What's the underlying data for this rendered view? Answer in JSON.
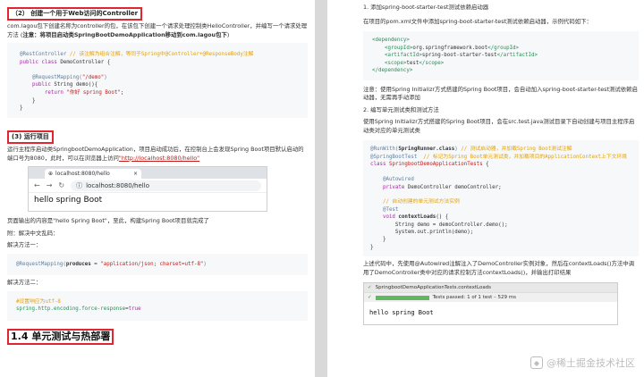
{
  "left": {
    "step2_title": "（2） 创建一个用于Web访问的Controller",
    "step2_desc": "com.lagou包下创建名称为controller的包，在该包下创建一个请求处理控制类HelloController，并编写一个请求处理方法 (",
    "step2_note": "注意：将项目启动类SpringBootDemoApplication移动到com.lagou包下",
    "step2_desc_end": ")",
    "code1": [
      {
        "parts": [
          {
            "c": "ann",
            "t": "@RestController "
          },
          {
            "c": "cm",
            "t": "// 该注解为组合注解，等同于Spring中@Controller+@ResponseBody注解"
          }
        ]
      },
      {
        "parts": [
          {
            "c": "kw",
            "t": "public class "
          },
          {
            "c": "",
            "t": "DemoController {"
          }
        ]
      },
      {
        "parts": [
          {
            "c": "",
            "t": ""
          }
        ]
      },
      {
        "parts": [
          {
            "c": "ann",
            "t": "    @RequestMapping("
          },
          {
            "c": "str",
            "t": "\"/demo\""
          },
          {
            "c": "ann",
            "t": ")"
          }
        ]
      },
      {
        "parts": [
          {
            "c": "kw",
            "t": "    public "
          },
          {
            "c": "",
            "t": "String demo(){"
          }
        ]
      },
      {
        "parts": [
          {
            "c": "kw",
            "t": "        return "
          },
          {
            "c": "str",
            "t": "\"你好 spring Boot\""
          },
          {
            "c": "",
            "t": ";"
          }
        ]
      },
      {
        "parts": [
          {
            "c": "",
            "t": "    }"
          }
        ]
      },
      {
        "parts": [
          {
            "c": "",
            "t": "}"
          }
        ]
      }
    ],
    "step3_title": "(3) 运行项目",
    "step3_desc": "运行主程序启动类SpringbootDemoApplication，项目启动成功后，在控制台上会发现Spring Boot项目默认启动的端口号为8080，此时，可以在浏览器上访问",
    "step3_link": "\"http://localhost:8080/hello\"",
    "browser": {
      "tab_title": "localhost:8080/hello",
      "url": "localhost:8080/hello",
      "content": "hello spring Boot"
    },
    "result_text": "页面输出的内容是\"hello Spring Boot\"，至此，构建Spring Boot项目就完成了",
    "appendix": "附：解决中文乱码：",
    "method1": "解决方法一：",
    "code2": [
      {
        "parts": [
          {
            "c": "ann",
            "t": "@RequestMapping("
          },
          {
            "c": "b",
            "t": "produces"
          },
          {
            "c": "",
            "t": " = "
          },
          {
            "c": "str",
            "t": "\"application/json; charset=utf-8\""
          },
          {
            "c": "ann",
            "t": ")"
          }
        ]
      }
    ],
    "method2": "解决方法二：",
    "code3": [
      {
        "parts": [
          {
            "c": "cm",
            "t": "#设置响应为utf-8"
          }
        ]
      },
      {
        "parts": [
          {
            "c": "grn",
            "t": "spring.http.encoding.force-response"
          },
          {
            "c": "",
            "t": "="
          },
          {
            "c": "kw",
            "t": "true"
          }
        ]
      }
    ],
    "section_title": "1.4 单元测试与热部署"
  },
  "right": {
    "step1_title": "1. 添加spring-boot-starter-test测试依赖启动器",
    "step1_desc": "在项目的pom.xml文件中添加spring-boot-starter-test测试依赖启动器，示例代码如下：",
    "code4": [
      {
        "parts": [
          {
            "c": "grn",
            "t": "<dependency>"
          }
        ]
      },
      {
        "parts": [
          {
            "c": "grn",
            "t": "    <groupId>"
          },
          {
            "c": "",
            "t": "org.springframework.boot"
          },
          {
            "c": "grn",
            "t": "</groupId>"
          }
        ]
      },
      {
        "parts": [
          {
            "c": "grn",
            "t": "    <artifactId>"
          },
          {
            "c": "",
            "t": "spring-boot-starter-test"
          },
          {
            "c": "grn",
            "t": "</artifactId>"
          }
        ]
      },
      {
        "parts": [
          {
            "c": "grn",
            "t": "    <scope>"
          },
          {
            "c": "",
            "t": "test"
          },
          {
            "c": "grn",
            "t": "</scope>"
          }
        ]
      },
      {
        "parts": [
          {
            "c": "grn",
            "t": "</dependency>"
          }
        ]
      }
    ],
    "note": "注意：使用Spring Initializr方式搭建的Spring Boot项目，会自动加入spring-boot-starter-test测试依赖启动器，无需再手动添加",
    "step2_title": "2. 编写单元测试类和测试方法",
    "step2_desc": "使用Spring Initializr方式搭建的Spring Boot项目，会在src.test.java测试目录下自动创建与项目主程序启动类对应的单元测试类",
    "code5": [
      {
        "parts": [
          {
            "c": "ann",
            "t": "@RunWith("
          },
          {
            "c": "b",
            "t": "SpringRunner.class"
          },
          {
            "c": "ann",
            "t": ") "
          },
          {
            "c": "cm",
            "t": "// 测试启动器，并加载Spring Boot测试注解"
          }
        ]
      },
      {
        "parts": [
          {
            "c": "ann",
            "t": "@SpringBootTest  "
          },
          {
            "c": "cm",
            "t": "// 标记为Spring Boot单元测试类，并加载项目的ApplicationContext上下文环境"
          }
        ]
      },
      {
        "parts": [
          {
            "c": "kw",
            "t": "class "
          },
          {
            "c": "str",
            "t": "SpringbootDemoApplicationTests"
          },
          {
            "c": "",
            "t": " {"
          }
        ]
      },
      {
        "parts": [
          {
            "c": "",
            "t": ""
          }
        ]
      },
      {
        "parts": [
          {
            "c": "ann",
            "t": "    @Autowired"
          }
        ]
      },
      {
        "parts": [
          {
            "c": "kw",
            "t": "    private "
          },
          {
            "c": "",
            "t": "DemoController demoController;"
          }
        ]
      },
      {
        "parts": [
          {
            "c": "",
            "t": ""
          }
        ]
      },
      {
        "parts": [
          {
            "c": "cm",
            "t": "    // 自动创建的单元测试方法实例"
          }
        ]
      },
      {
        "parts": [
          {
            "c": "ann",
            "t": "    @Test"
          }
        ]
      },
      {
        "parts": [
          {
            "c": "kw",
            "t": "    void "
          },
          {
            "c": "b",
            "t": "contextLoads"
          },
          {
            "c": "",
            "t": "() {"
          }
        ]
      },
      {
        "parts": [
          {
            "c": "",
            "t": "        String demo = demoController.demo();"
          }
        ]
      },
      {
        "parts": [
          {
            "c": "",
            "t": "        System.out.println(demo);"
          }
        ]
      },
      {
        "parts": [
          {
            "c": "",
            "t": "    }"
          }
        ]
      },
      {
        "parts": [
          {
            "c": "",
            "t": "}"
          }
        ]
      }
    ],
    "desc3": "上述代码中，先使用@Autowired注解注入了DemoController实例对象，然后在contextLoads()方法中调用了DemoController类中对应的请求控制方法contextLoads()，并输出打印结果",
    "ide": {
      "tab_text": "SpringbootDemoApplicationTests.contextLoads",
      "status_text": "Tests passed: 1 of 1 test – 529 ms",
      "console": "hello spring Boot"
    }
  },
  "watermark": "@稀土掘金技术社区"
}
